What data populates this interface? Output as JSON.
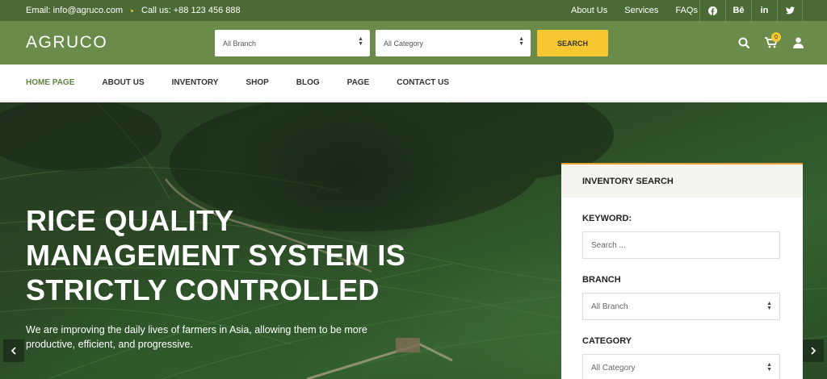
{
  "topbar": {
    "email": "Email: info@agruco.com",
    "phone": "Call us: +88 123 456 888",
    "links": [
      "About Us",
      "Services",
      "FAQs"
    ],
    "social": [
      "facebook-icon",
      "behance-icon",
      "linkedin-icon",
      "twitter-icon"
    ],
    "social_labels": {
      "behance": "Bē",
      "linkedin": "in"
    }
  },
  "header": {
    "logo": "AGRUCO",
    "branch_select": "All Branch",
    "category_select": "All Category",
    "search_button": "SEARCH",
    "cart_count": "0"
  },
  "nav": {
    "items": [
      "HOME PAGE",
      "ABOUT US",
      "INVENTORY",
      "SHOP",
      "BLOG",
      "PAGE",
      "CONTACT US"
    ],
    "active": "HOME PAGE"
  },
  "hero": {
    "title": "RICE QUALITY MANAGEMENT SYSTEM IS STRICTLY CONTROLLED",
    "text": "We are improving the daily lives of farmers in Asia, allowing them to be more productive, efficient, and progressive."
  },
  "inventory": {
    "title": "INVENTORY SEARCH",
    "keyword_label": "KEYWORD:",
    "keyword_placeholder": "Search ...",
    "branch_label": "BRANCH",
    "branch_value": "All Branch",
    "category_label": "CATEGORY",
    "category_value": "All Category"
  },
  "colors": {
    "topbar": "#4b6a35",
    "header": "#6a8b4a",
    "accent": "#f6c731",
    "nav_active": "#5e8443"
  }
}
